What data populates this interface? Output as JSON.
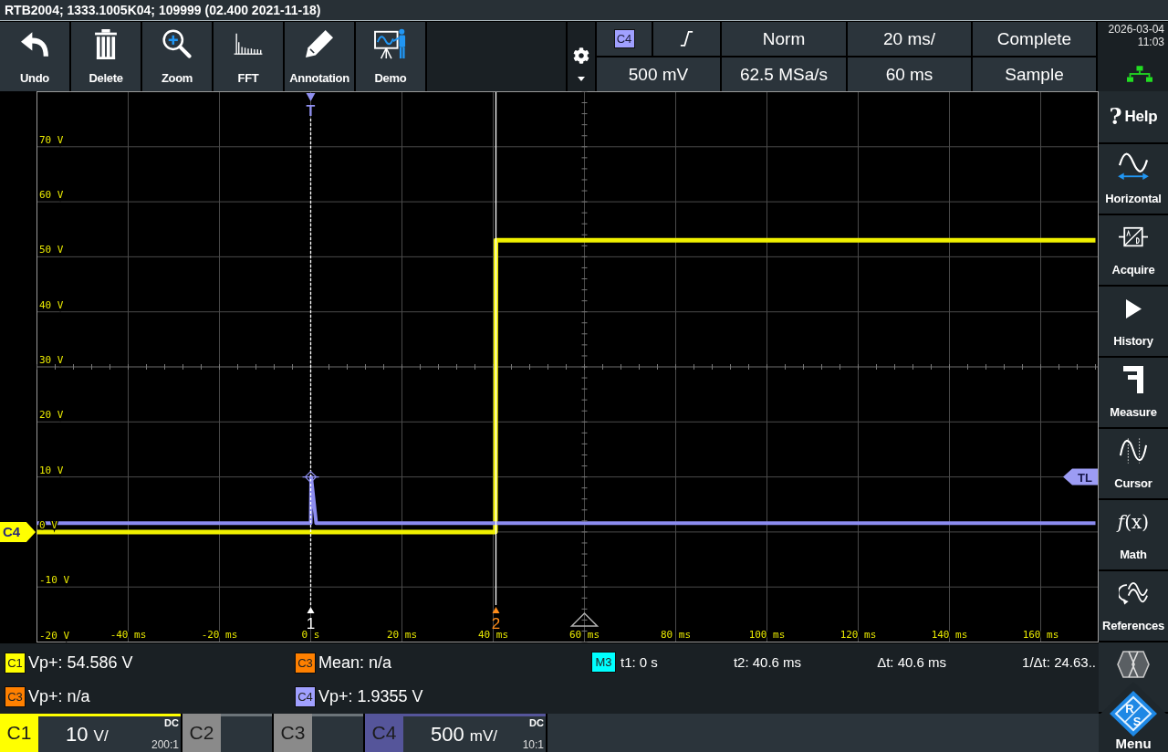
{
  "title_bar": {
    "text": "RTB2004; 1333.1005K04; 109999 (02.400 2021-11-18)"
  },
  "toolbar": [
    {
      "kind": "undo",
      "label": "Undo"
    },
    {
      "kind": "delete",
      "label": "Delete"
    },
    {
      "kind": "zoom",
      "label": "Zoom"
    },
    {
      "kind": "fft",
      "label": "FFT"
    },
    {
      "kind": "annotation",
      "label": "Annotation"
    },
    {
      "kind": "demo",
      "label": "Demo"
    }
  ],
  "acquisition": {
    "source": {
      "label": "C4",
      "color": "#a0a0ff"
    },
    "trigger_mode": "Norm",
    "time_scale": "20 ms/",
    "acquire_state": "Complete",
    "trigger_level": "500 mV",
    "sample_rate": "62.5 MSa/s",
    "horizontal_position": "60 ms",
    "acquire_mode": "Sample"
  },
  "clock": {
    "date": "2026-03-04",
    "time": "11:03"
  },
  "plot": {
    "chart_data": {
      "type": "line",
      "grid": true,
      "x": [
        -60,
        0,
        0.1,
        1.2,
        40.5,
        40.6,
        172
      ],
      "series": [
        {
          "color": "#f0f000",
          "values": [
            0,
            0,
            0,
            0,
            0,
            53,
            53
          ]
        },
        {
          "color": "#8c8cf0",
          "values": [
            1.6,
            1.6,
            10,
            1.6,
            1.6,
            1.6,
            1.6
          ]
        }
      ],
      "xlim": [
        -60,
        172.6
      ],
      "ylim": [
        -20,
        80
      ],
      "xticks": [
        {
          "value": -40,
          "label": "-40 ms"
        },
        {
          "value": -20,
          "label": "-20 ms"
        },
        {
          "value": 0,
          "label": "0 s"
        },
        {
          "value": 20,
          "label": "20 ms"
        },
        {
          "value": 40,
          "label": "40 ms"
        },
        {
          "value": 60,
          "label": "60 ms"
        },
        {
          "value": 80,
          "label": "80 ms"
        },
        {
          "value": 100,
          "label": "100 ms"
        },
        {
          "value": 120,
          "label": "120 ms"
        },
        {
          "value": 140,
          "label": "140 ms"
        },
        {
          "value": 160,
          "label": "160 ms"
        }
      ],
      "yticks": [
        {
          "value": -20,
          "label": "-20 V"
        },
        {
          "value": -10,
          "label": "-10 V"
        },
        {
          "value": 0,
          "label": "0 V"
        },
        {
          "value": 10,
          "label": "10 V"
        },
        {
          "value": 20,
          "label": "20 V"
        },
        {
          "value": 30,
          "label": "30 V"
        },
        {
          "value": 40,
          "label": "40 V"
        },
        {
          "value": 50,
          "label": "50 V"
        },
        {
          "value": 60,
          "label": "60 V"
        },
        {
          "value": 70,
          "label": "70 V"
        }
      ]
    },
    "markers": [
      {
        "kind": "trigger",
        "label": "T",
        "color": "#9090f0"
      },
      {
        "kind": "cursor",
        "label": "1",
        "color": "#ffffff"
      },
      {
        "kind": "cursor",
        "label": "2",
        "color": "#ff8c1a"
      },
      {
        "kind": "trigger_point",
        "color": "#9090f0"
      },
      {
        "kind": "trigger_level",
        "label": "TL",
        "color": "#9c9cf4"
      },
      {
        "kind": "position"
      },
      {
        "kind": "ground",
        "label": "C4",
        "color": "#ffff00"
      }
    ]
  },
  "measurements": [
    {
      "badge": "C1",
      "color": "#ffff00",
      "text": "Vp+: 54.586 V"
    },
    {
      "badge": "C3",
      "color": "#ff8000",
      "text": "Mean: n/a"
    },
    {
      "badge": "C3",
      "color": "#ff8000",
      "text": "Vp+: n/a"
    },
    {
      "badge": "C4",
      "color": "#a0a0ff",
      "text": "Vp+: 1.9355 V"
    }
  ],
  "cursor_readout": {
    "badge": "M3",
    "color": "#00ffff",
    "values": [
      "t1: 0 s",
      "t2: 40.6 ms",
      "Δt: 40.6 ms",
      "1/Δt: 24.63.."
    ]
  },
  "channels": [
    {
      "label": "C1",
      "on": true,
      "color": "#ffff00",
      "scale": "10",
      "unit": "V/",
      "coupling": "DC",
      "probe": "200:1"
    },
    {
      "label": "C2",
      "on": false
    },
    {
      "label": "C3",
      "on": false
    },
    {
      "label": "C4",
      "on": true,
      "color": "#55559a",
      "scale": "500",
      "unit": "mV/",
      "coupling": "DC",
      "probe": "10:1"
    }
  ],
  "sidebar": [
    {
      "kind": "help",
      "glyph": "?",
      "label": "Help"
    },
    {
      "kind": "horizontal",
      "label": "Horizontal"
    },
    {
      "kind": "acquire",
      "label": "Acquire"
    },
    {
      "kind": "history",
      "label": "History"
    },
    {
      "kind": "measure",
      "label": "Measure"
    },
    {
      "kind": "cursor",
      "label": "Cursor"
    },
    {
      "kind": "math",
      "glyph": "*f*(x)",
      "label": "Math"
    },
    {
      "kind": "references",
      "label": "References"
    },
    {
      "kind": "protocol"
    }
  ],
  "menu": {
    "label": "Menu",
    "logo_letters": [
      "R",
      "S"
    ]
  }
}
